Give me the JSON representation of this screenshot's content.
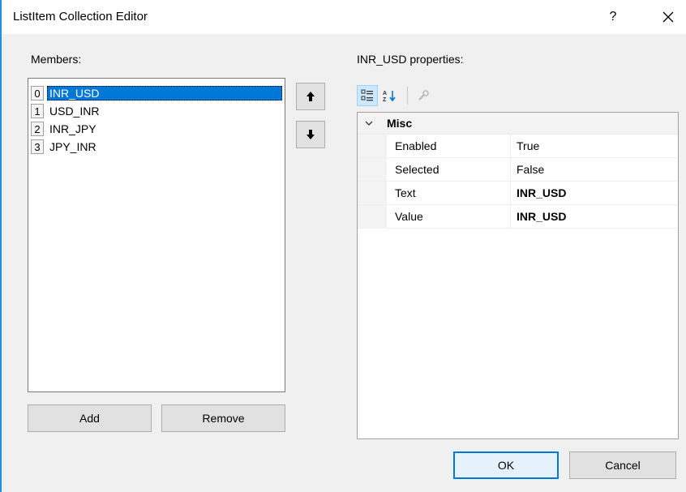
{
  "window": {
    "title": "ListItem Collection Editor",
    "help": "?",
    "close": "✕"
  },
  "members": {
    "label": "Members:",
    "items": [
      {
        "index": "0",
        "text": "INR_USD",
        "selected": true
      },
      {
        "index": "1",
        "text": "USD_INR",
        "selected": false
      },
      {
        "index": "2",
        "text": "INR_JPY",
        "selected": false
      },
      {
        "index": "3",
        "text": "JPY_INR",
        "selected": false
      }
    ],
    "add_label": "Add",
    "remove_label": "Remove",
    "move_up_icon": "arrow-up-icon",
    "move_down_icon": "arrow-down-icon"
  },
  "properties": {
    "label": "INR_USD properties:",
    "toolbar": [
      "categorized-icon",
      "alphabetical-icon",
      "property-pages-icon"
    ],
    "category": "Misc",
    "rows": [
      {
        "name": "Enabled",
        "value": "True",
        "bold": false
      },
      {
        "name": "Selected",
        "value": "False",
        "bold": false
      },
      {
        "name": "Text",
        "value": "INR_USD",
        "bold": true
      },
      {
        "name": "Value",
        "value": "INR_USD",
        "bold": true
      }
    ]
  },
  "footer": {
    "ok_label": "OK",
    "cancel_label": "Cancel"
  },
  "colors": {
    "selection": "#0078d7",
    "dialog_background": "#f0f0f0",
    "button_background": "#e1e1e1"
  }
}
